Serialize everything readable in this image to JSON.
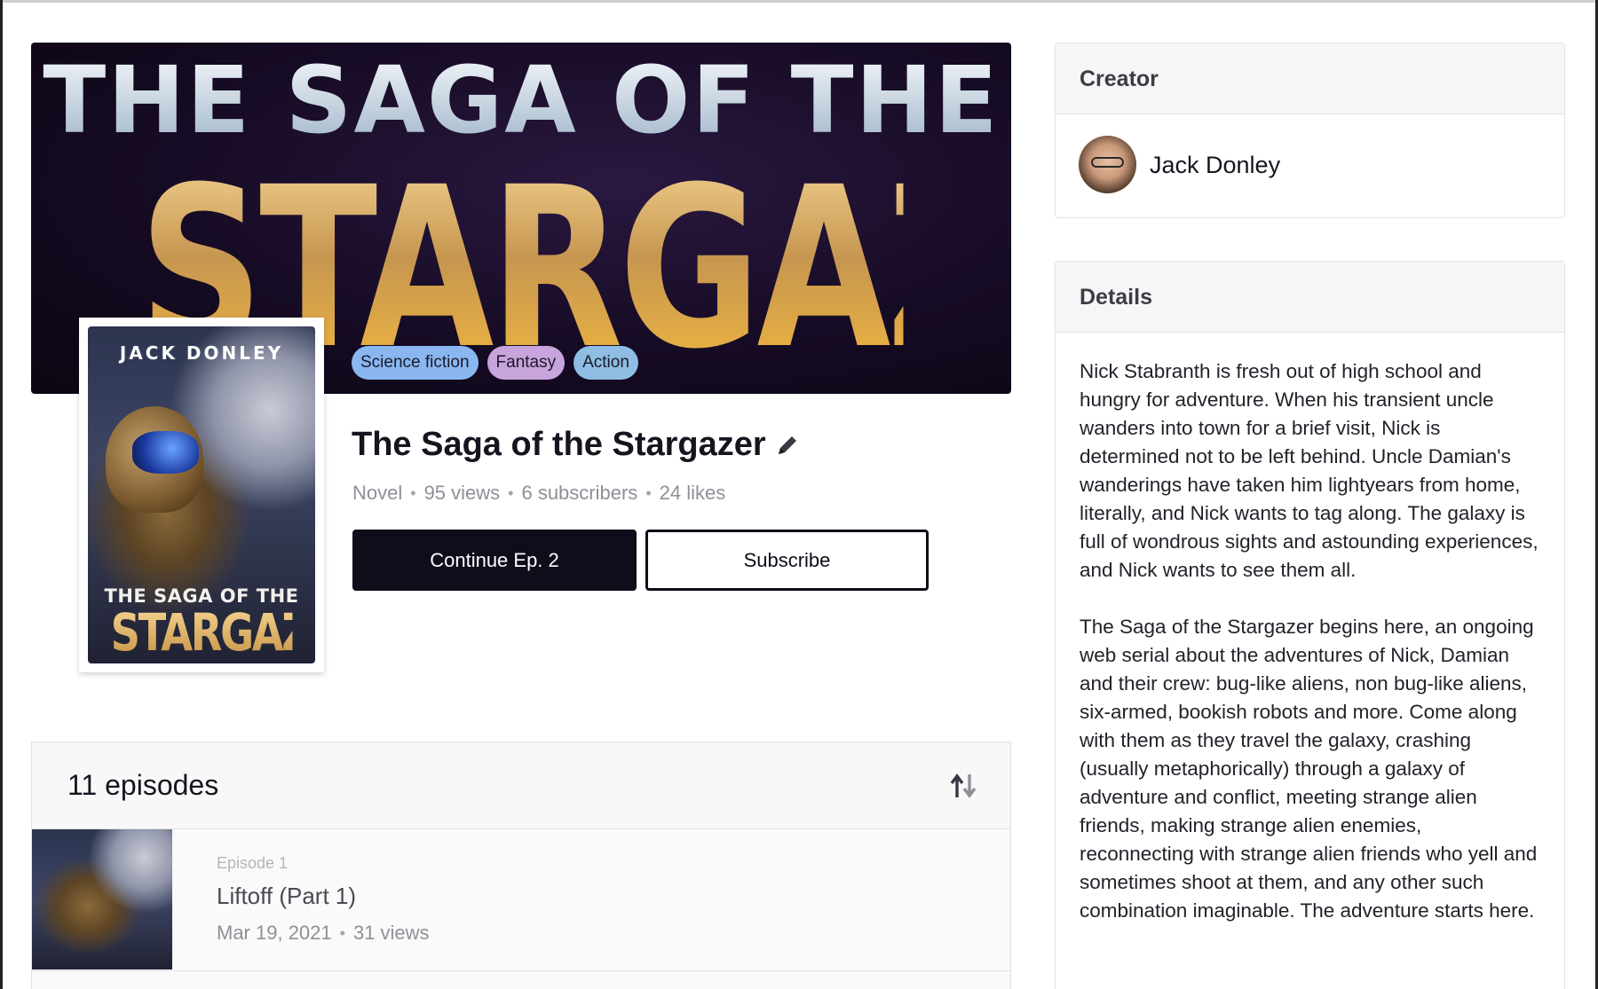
{
  "banner": {
    "line1": "THE SAGA OF THE",
    "line2": "STARGAZER"
  },
  "cover": {
    "author": "JACK DONLEY",
    "title_small": "THE SAGA OF THE",
    "title_big": "STARGAZER"
  },
  "genres": [
    {
      "label": "Science fiction",
      "color": "#8ab7f0"
    },
    {
      "label": "Fantasy",
      "color": "#c8a4dc"
    },
    {
      "label": "Action",
      "color": "#8fbde3"
    }
  ],
  "series": {
    "title": "The Saga of the Stargazer",
    "type": "Novel",
    "views": "95 views",
    "subscribers": "6 subscribers",
    "likes": "24 likes",
    "continue_label": "Continue Ep. 2",
    "subscribe_label": "Subscribe"
  },
  "episodes": {
    "count_label": "11 episodes",
    "items": [
      {
        "label": "Episode 1",
        "name": "Liftoff (Part 1)",
        "date": "Mar 19, 2021",
        "views": "31 views"
      }
    ]
  },
  "creator": {
    "header": "Creator",
    "name": "Jack Donley"
  },
  "details": {
    "header": "Details",
    "paragraph1": "Nick Stabranth is fresh out of high school and hungry for adventure. When his transient uncle wanders into town for a brief visit, Nick is determined not to be left behind. Uncle Damian's wanderings have taken him lightyears from home, literally, and Nick wants to tag along. The galaxy is full of wondrous sights and astounding experiences, and Nick wants to see them all.",
    "paragraph2": "The Saga of the Stargazer begins here, an ongoing web serial about the adventures of Nick, Damian and their crew: bug-like aliens, non bug-like aliens, six-armed, bookish robots and more. Come along with them as they travel the galaxy, crashing (usually metaphorically) through a galaxy of adventure and conflict, meeting strange alien friends, making strange alien enemies, reconnecting with strange alien friends who yell and sometimes shoot at them, and any other such combination imaginable. The adventure starts here."
  },
  "icons": {
    "edit": "pencil-icon",
    "sort": "sort-arrows-icon"
  }
}
